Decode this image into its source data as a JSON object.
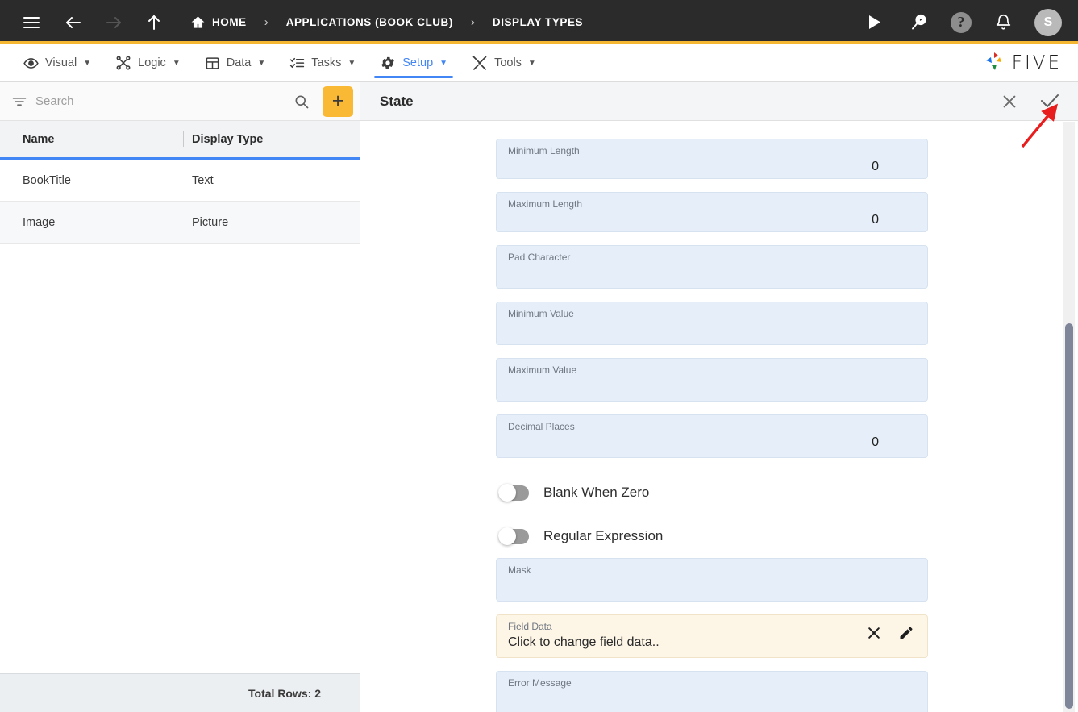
{
  "topbar": {
    "menu_icon": "hamburger-icon",
    "back_icon": "arrow-left-icon",
    "forward_icon": "arrow-right-icon",
    "up_icon": "arrow-up-icon",
    "breadcrumbs": [
      {
        "label": "HOME",
        "icon": "home-icon"
      },
      {
        "label": "APPLICATIONS (BOOK CLUB)",
        "icon": ""
      },
      {
        "label": "DISPLAY TYPES",
        "icon": ""
      }
    ],
    "separator": "›",
    "actions": [
      {
        "name": "run-icon",
        "glyph": "▶"
      },
      {
        "name": "search-play-icon",
        "glyph": ""
      },
      {
        "name": "help-icon",
        "glyph": "?"
      },
      {
        "name": "notifications-bell-icon",
        "glyph": ""
      }
    ],
    "avatar_initial": "S",
    "accent_color": "#f5b731",
    "background_color": "#2b2b2b"
  },
  "menubar": {
    "items": [
      {
        "label": "Visual",
        "icon": "eye-icon",
        "active": false
      },
      {
        "label": "Logic",
        "icon": "logic-nodes-icon",
        "active": false
      },
      {
        "label": "Data",
        "icon": "table-icon",
        "active": false
      },
      {
        "label": "Tasks",
        "icon": "checklist-icon",
        "active": false
      },
      {
        "label": "Setup",
        "icon": "gear-icon",
        "active": true
      },
      {
        "label": "Tools",
        "icon": "tools-icon",
        "active": false
      }
    ],
    "caret": "▼",
    "brand": "FIVE",
    "active_color": "#4285f4"
  },
  "left_panel": {
    "search": {
      "placeholder": "Search",
      "value": ""
    },
    "filter_icon": "filter-icon",
    "search_icon": "search-icon",
    "add_button_label": "+",
    "add_button_color": "#f9b934",
    "columns": [
      "Name",
      "Display Type"
    ],
    "rows": [
      {
        "name": "BookTitle",
        "display_type": "Text"
      },
      {
        "name": "Image",
        "display_type": "Picture"
      }
    ],
    "footer": "Total Rows: 2"
  },
  "right_panel": {
    "title": "State",
    "close_icon": "close-icon",
    "confirm_icon": "check-icon",
    "fields": [
      {
        "label": "Minimum Length",
        "value": "0",
        "type": "number"
      },
      {
        "label": "Maximum Length",
        "value": "0",
        "type": "number"
      },
      {
        "label": "Pad Character",
        "value": "",
        "type": "text"
      },
      {
        "label": "Minimum Value",
        "value": "",
        "type": "text"
      },
      {
        "label": "Maximum Value",
        "value": "",
        "type": "text"
      },
      {
        "label": "Decimal Places",
        "value": "0",
        "type": "number"
      }
    ],
    "toggles": [
      {
        "label": "Blank When Zero",
        "on": false
      },
      {
        "label": "Regular Expression",
        "on": false
      }
    ],
    "mask_field": {
      "label": "Mask",
      "value": ""
    },
    "field_data": {
      "label": "Field Data",
      "value": "Click to change field data..",
      "clear_icon": "close-icon",
      "edit_icon": "pencil-icon",
      "highlight_color": "#fdf5e6"
    },
    "error_field": {
      "label": "Error Message",
      "value": ""
    },
    "field_background": "#e6eff9"
  },
  "annotation": {
    "arrow_color": "#e81e1e",
    "points_at": "confirm-check-button"
  }
}
